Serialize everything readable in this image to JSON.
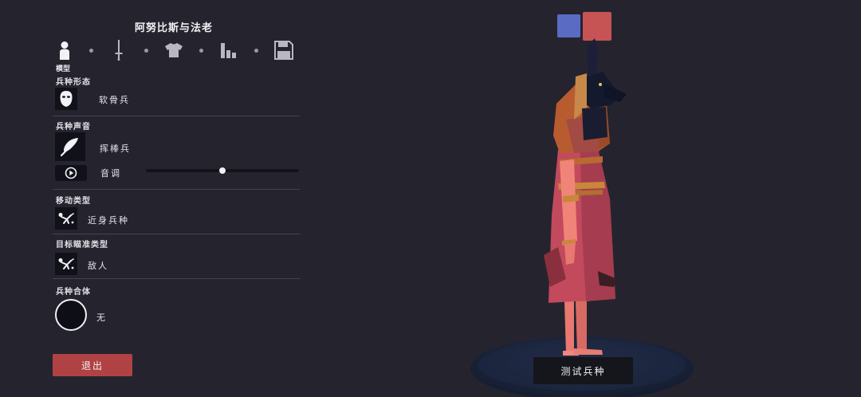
{
  "unit_name": "阿努比斯与法老",
  "tabs": {
    "active_label": "模型",
    "icons": [
      "person-icon",
      "sword-icon",
      "shirt-icon",
      "bar-chart-icon",
      "save-icon"
    ]
  },
  "sections": {
    "unit_form": {
      "label": "兵种形态",
      "value": "软骨兵",
      "icon": "mask-icon"
    },
    "unit_voice": {
      "label": "兵种声音",
      "value": "挥棒兵",
      "icon": "feather-icon"
    },
    "pitch": {
      "label": "音调",
      "level": 0.5,
      "icon": "play-icon"
    },
    "movement": {
      "label": "移动类型",
      "value": "近身兵种",
      "icon": "fallen-figure-icon"
    },
    "targeting": {
      "label": "目标瞄准类型",
      "value": "敌人",
      "icon": "fallen-figure-icon"
    },
    "fusion": {
      "label": "兵种合体",
      "value": "无",
      "icon": "circle-icon"
    }
  },
  "buttons": {
    "exit": "退出",
    "test": "测试兵种"
  },
  "team_colors": {
    "blue": "#5a6bc4",
    "red": "#c65454"
  }
}
